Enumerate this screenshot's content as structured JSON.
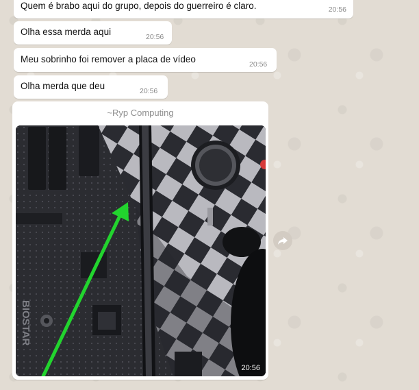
{
  "messages": [
    {
      "text": "Quem é brabo aqui do grupo, depois do guerreiro é claro.",
      "time": "20:56"
    },
    {
      "text": "Olha essa merda aqui",
      "time": "20:56"
    },
    {
      "text": "Meu sobrinho foi remover a placa de vídeo",
      "time": "20:56"
    },
    {
      "text": "Olha merda que deu",
      "time": "20:56"
    }
  ],
  "image_message": {
    "sender": "~Ryp Computing",
    "time": "20:56",
    "board_brand": "BIOSTAR"
  },
  "icons": {
    "forward": "forward-arrow-icon"
  },
  "colors": {
    "chat_background": "#e2dcd3",
    "bubble_background": "#ffffff",
    "timestamp_text": "#8a8a8a",
    "annotation_arrow": "#22d42e"
  }
}
